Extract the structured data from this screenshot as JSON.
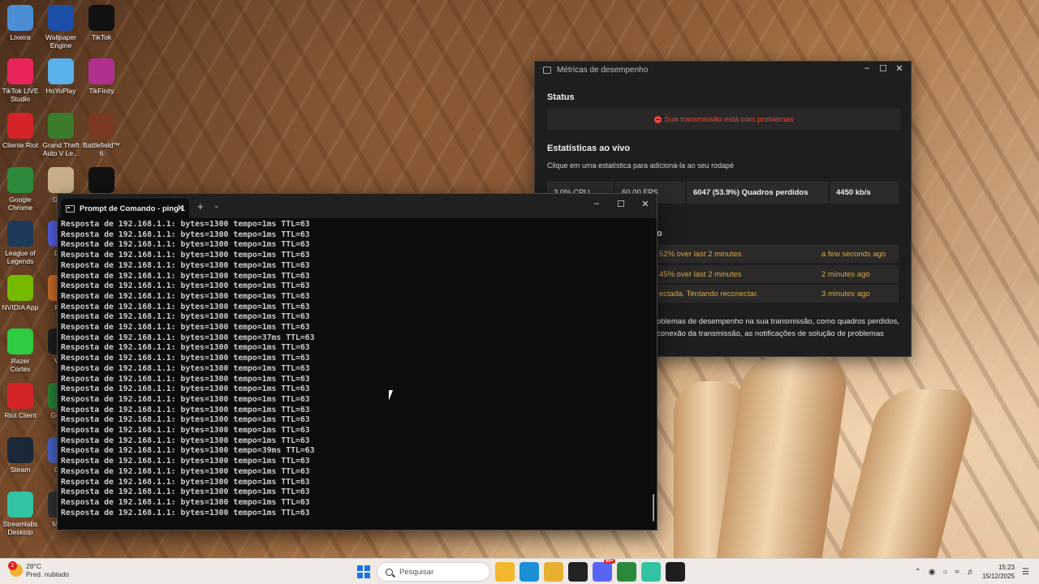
{
  "desktop_icons": [
    {
      "label": "Lixeira",
      "icon": "recycle-bin-icon",
      "color": "#4a8fd6"
    },
    {
      "label": "Wallpaper Engine",
      "icon": "wallpaper-engine-icon",
      "color": "#1d4fa8"
    },
    {
      "label": "TikTok",
      "icon": "tiktok-icon",
      "color": "#111111"
    },
    {
      "label": "TikTok LIVE Studio",
      "icon": "tiktok-live-icon",
      "color": "#e8245a"
    },
    {
      "label": "HoYoPlay",
      "icon": "hoyoplay-icon",
      "color": "#5ab0e8"
    },
    {
      "label": "TikFinity",
      "icon": "tikfinity-icon",
      "color": "#b03090"
    },
    {
      "label": "Cliente Riot",
      "icon": "riot-client-icon",
      "color": "#d4242a"
    },
    {
      "label": "Grand Theft Auto V Le...",
      "icon": "gta-icon",
      "color": "#3c7a2c"
    },
    {
      "label": "Battlefield™ 6",
      "icon": "battlefield-icon",
      "color": "#7a3a20"
    },
    {
      "label": "Google Chrome",
      "icon": "chrome-icon",
      "color": "#2a8a3a"
    },
    {
      "label": "Ge In",
      "icon": "genshin-icon",
      "color": "#c9b08a"
    },
    {
      "label": "",
      "icon": "capcut-icon",
      "color": "#111111"
    },
    {
      "label": "League of Legends",
      "icon": "league-icon",
      "color": "#1e3a5a"
    },
    {
      "label": "Di C",
      "icon": "discord-icon",
      "color": "#5865f2"
    },
    {
      "label": "NVIDIA App",
      "icon": "nvidia-icon",
      "color": "#76b900"
    },
    {
      "label": "Fi A",
      "icon": "app-icon",
      "color": "#d4742a"
    },
    {
      "label": "Razer Cortex",
      "icon": "razer-cortex-icon",
      "color": "#2ecc40"
    },
    {
      "label": "Voic",
      "icon": "voicemod-icon",
      "color": "#1e1e1e"
    },
    {
      "label": "Riot Client",
      "icon": "riot-client-icon",
      "color": "#d4242a"
    },
    {
      "label": "Goo G",
      "icon": "google-icon",
      "color": "#2a8a3a"
    },
    {
      "label": "Steam",
      "icon": "steam-icon",
      "color": "#1b2838"
    },
    {
      "label": "Clas",
      "icon": "app-icon",
      "color": "#4a6ad0"
    },
    {
      "label": "Streamlabs Desktop",
      "icon": "streamlabs-icon",
      "color": "#31c3a2"
    },
    {
      "label": "Mi Eq",
      "icon": "app-icon",
      "color": "#333333"
    }
  ],
  "metrics_window": {
    "title": "Métricas de desempenho",
    "status_heading": "Status",
    "alert": "Sua transmissão está com problemas",
    "alert_color": "#e24a3b",
    "live_stats_heading": "Estatísticas ao vivo",
    "live_stats_hint": "Clique em uma estatística para adicioná-la ao seu rodapé",
    "stats": [
      "3.0% CPU",
      "60.00 FPS",
      "6047 (53.9%) Quadros perdidos",
      "4450 kb/s"
    ],
    "notifications_heading_fragment": "o",
    "notifications": [
      {
        "message": "52% over last 2 minutes",
        "time": "a few seconds ago"
      },
      {
        "message": "45% over last 2 minutes",
        "time": "2 minutes ago"
      },
      {
        "message": "ectada. Tentando reconectar.",
        "time": "3 minutes ago"
      }
    ],
    "notification_color": "#d6a84e",
    "description_line1": "oblemas de desempenho na sua transmissão, como quadros perdidos,",
    "description_line2": "conexão da transmissão, as notificações de solução de problemas"
  },
  "terminal": {
    "tab_title": "Prompt de Comando - ping 1",
    "lines": [
      "Resposta de 192.168.1.1: bytes=1300 tempo=1ms TTL=63",
      "Resposta de 192.168.1.1: bytes=1300 tempo=1ms TTL=63",
      "Resposta de 192.168.1.1: bytes=1300 tempo=1ms TTL=63",
      "Resposta de 192.168.1.1: bytes=1300 tempo=1ms TTL=63",
      "Resposta de 192.168.1.1: bytes=1300 tempo=1ms TTL=63",
      "Resposta de 192.168.1.1: bytes=1300 tempo=1ms TTL=63",
      "Resposta de 192.168.1.1: bytes=1300 tempo=1ms TTL=63",
      "Resposta de 192.168.1.1: bytes=1300 tempo=1ms TTL=63",
      "Resposta de 192.168.1.1: bytes=1300 tempo=1ms TTL=63",
      "Resposta de 192.168.1.1: bytes=1300 tempo=1ms TTL=63",
      "Resposta de 192.168.1.1: bytes=1300 tempo=1ms TTL=63",
      "Resposta de 192.168.1.1: bytes=1300 tempo=37ms TTL=63",
      "Resposta de 192.168.1.1: bytes=1300 tempo=1ms TTL=63",
      "Resposta de 192.168.1.1: bytes=1300 tempo=1ms TTL=63",
      "Resposta de 192.168.1.1: bytes=1300 tempo=1ms TTL=63",
      "Resposta de 192.168.1.1: bytes=1300 tempo=1ms TTL=63",
      "Resposta de 192.168.1.1: bytes=1300 tempo=1ms TTL=63",
      "Resposta de 192.168.1.1: bytes=1300 tempo=1ms TTL=63",
      "Resposta de 192.168.1.1: bytes=1300 tempo=1ms TTL=63",
      "Resposta de 192.168.1.1: bytes=1300 tempo=1ms TTL=63",
      "Resposta de 192.168.1.1: bytes=1300 tempo=1ms TTL=63",
      "Resposta de 192.168.1.1: bytes=1300 tempo=1ms TTL=63",
      "Resposta de 192.168.1.1: bytes=1300 tempo=39ms TTL=63",
      "Resposta de 192.168.1.1: bytes=1300 tempo=1ms TTL=63",
      "Resposta de 192.168.1.1: bytes=1300 tempo=1ms TTL=63",
      "Resposta de 192.168.1.1: bytes=1300 tempo=1ms TTL=63",
      "Resposta de 192.168.1.1: bytes=1300 tempo=1ms TTL=63",
      "Resposta de 192.168.1.1: bytes=1300 tempo=1ms TTL=63",
      "Resposta de 192.168.1.1: bytes=1300 tempo=1ms TTL=63"
    ]
  },
  "taskbar": {
    "weather_temp": "28°C",
    "weather_desc": "Pred. nublado",
    "weather_badge": "2",
    "search_placeholder": "Pesquisar",
    "notification_count": "99+",
    "time": "15:23",
    "date": "15/12/2025",
    "apps": [
      {
        "icon": "file-explorer-icon",
        "color": "#f2b72c"
      },
      {
        "icon": "edge-icon",
        "color": "#1a8fd6"
      },
      {
        "icon": "folder-icon",
        "color": "#e8b030"
      },
      {
        "icon": "sticky-notes-icon",
        "color": "#222222"
      },
      {
        "icon": "discord-icon",
        "color": "#5865f2"
      },
      {
        "icon": "chrome-icon",
        "color": "#2a8a3a"
      },
      {
        "icon": "streamlabs-icon",
        "color": "#31c3a2"
      },
      {
        "icon": "terminal-icon",
        "color": "#1e1e1e"
      }
    ]
  }
}
